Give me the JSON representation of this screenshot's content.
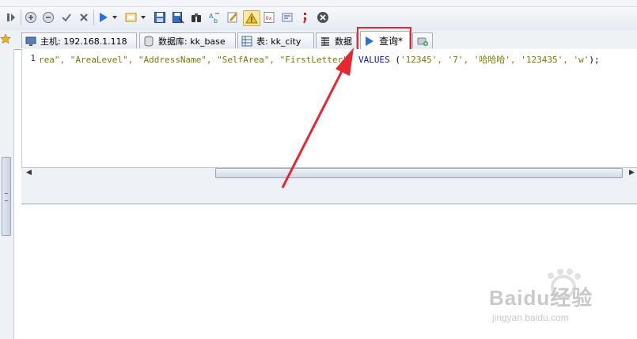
{
  "toolbar": {
    "buttons": [
      {
        "name": "step-icon"
      },
      {
        "name": "add-record-icon"
      },
      {
        "name": "delete-record-icon"
      },
      {
        "name": "apply-icon"
      },
      {
        "name": "cancel-icon"
      },
      {
        "name": "run-icon"
      },
      {
        "name": "open-query-icon"
      },
      {
        "name": "save-icon"
      },
      {
        "name": "save-as-icon"
      },
      {
        "name": "binoculars-icon"
      },
      {
        "name": "format-icon"
      },
      {
        "name": "edit-icon"
      },
      {
        "name": "warning-icon"
      },
      {
        "name": "hex-icon"
      },
      {
        "name": "wrap-icon"
      },
      {
        "name": "semicolon-icon"
      },
      {
        "name": "stop-icon"
      }
    ]
  },
  "tabs": [
    {
      "label": "主机: 192.168.1.118",
      "icon": "monitor-icon"
    },
    {
      "label": "数据库: kk_base",
      "icon": "database-icon"
    },
    {
      "label": "表: kk_city",
      "icon": "table-icon"
    },
    {
      "label": "数据",
      "icon": "data-grid-icon"
    },
    {
      "label": "查询*",
      "icon": "play-icon",
      "active": true
    },
    {
      "label": "",
      "icon": "new-tab-icon"
    }
  ],
  "editor": {
    "line_number": "1",
    "tokens": [
      {
        "t": "rea\", ",
        "c": "str"
      },
      {
        "t": "\"AreaLevel\", ",
        "c": "str"
      },
      {
        "t": "\"AddressName\", ",
        "c": "str"
      },
      {
        "t": "\"SelfArea\", ",
        "c": "str"
      },
      {
        "t": "\"FirstLetter\"",
        "c": "str"
      },
      {
        "t": ") ",
        "c": "par"
      },
      {
        "t": "VALUES ",
        "c": "kw"
      },
      {
        "t": "(",
        "c": "par"
      },
      {
        "t": "'12345', ",
        "c": "str"
      },
      {
        "t": "'7', ",
        "c": "str"
      },
      {
        "t": "'哈哈哈', ",
        "c": "str"
      },
      {
        "t": "'123435', ",
        "c": "str"
      },
      {
        "t": "'w'",
        "c": "str"
      },
      {
        "t": ");",
        "c": "par"
      }
    ]
  },
  "watermark": {
    "brand": "Baidu经验",
    "url": "jingyan.baidu.com"
  },
  "colors": {
    "highlight": "#e8262f",
    "keyword": "#1010c8",
    "string": "#7a7a00"
  }
}
